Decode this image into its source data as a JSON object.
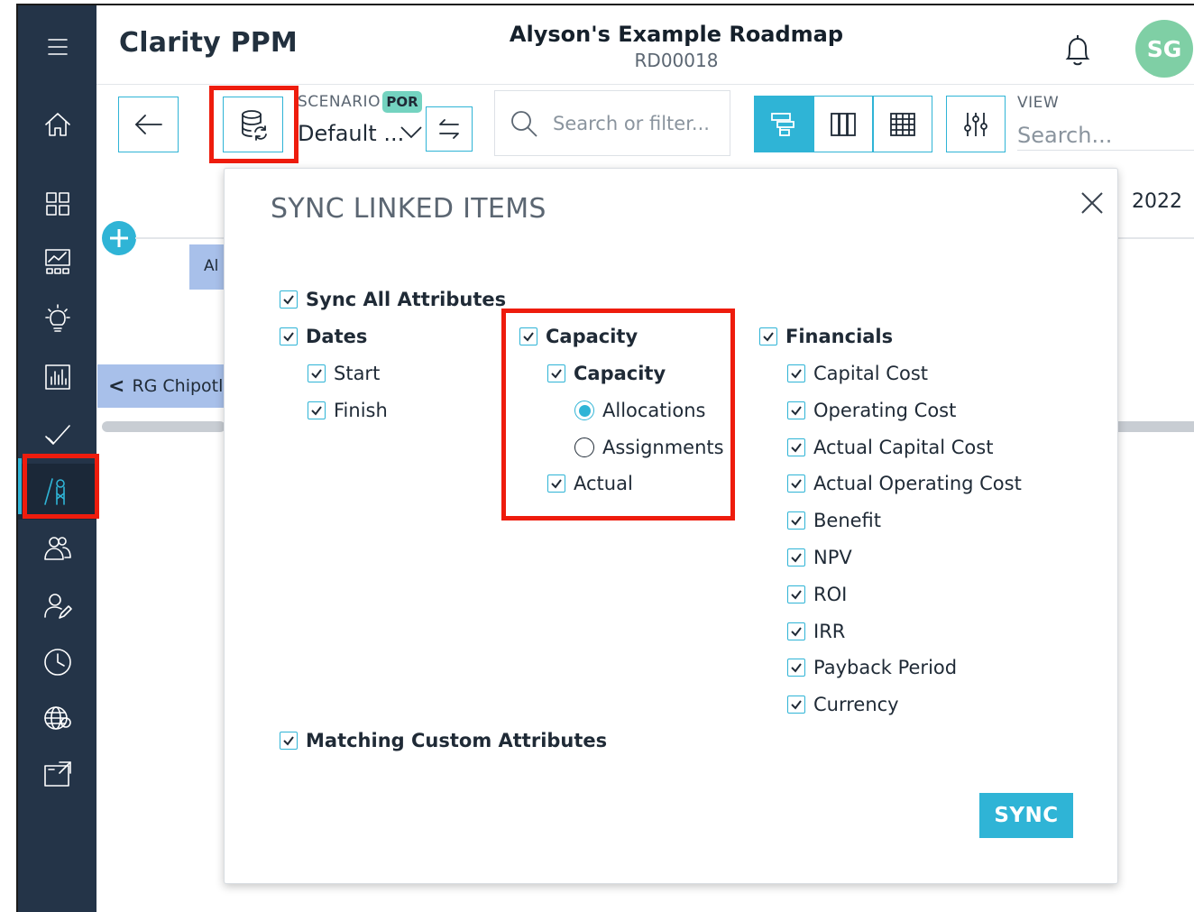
{
  "header": {
    "app_title": "Clarity PPM",
    "roadmap_title": "Alyson's Example Roadmap",
    "roadmap_id": "RD00018",
    "avatar_initials": "SG"
  },
  "toolbar": {
    "scenario_label": "SCENARIO",
    "scenario_badge": "POR",
    "scenario_value": "Default ...",
    "search_placeholder": "Search or filter...",
    "view_label": "VIEW",
    "view_placeholder": "Search..."
  },
  "background": {
    "year": "2022",
    "bar_label": "Al",
    "group_label": "RG Chipotle"
  },
  "modal": {
    "title": "SYNC LINKED ITEMS",
    "sync_all": "Sync All Attributes",
    "dates": {
      "label": "Dates",
      "start": "Start",
      "finish": "Finish"
    },
    "capacity": {
      "label": "Capacity",
      "sub_label": "Capacity",
      "allocations": "Allocations",
      "assignments": "Assignments",
      "actual": "Actual",
      "selected": "Allocations"
    },
    "financials": {
      "label": "Financials",
      "items": [
        "Capital Cost",
        "Operating Cost",
        "Actual Capital Cost",
        "Actual Operating Cost",
        "Benefit",
        "NPV",
        "ROI",
        "IRR",
        "Payback Period",
        "Currency"
      ]
    },
    "matching_custom": "Matching Custom Attributes",
    "sync_button": "SYNC"
  },
  "colors": {
    "sidebar": "#243448",
    "accent": "#2fb4d6",
    "highlight": "#ee1c0d",
    "avatar": "#7fcfa5",
    "badge": "#74d3c0"
  }
}
